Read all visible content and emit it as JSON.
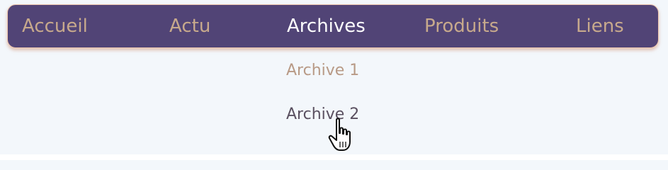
{
  "nav": {
    "items": [
      {
        "label": "Accueil",
        "active": false
      },
      {
        "label": "Actu",
        "active": false
      },
      {
        "label": "Archives",
        "active": true
      },
      {
        "label": "Produits",
        "active": false
      },
      {
        "label": "Liens",
        "active": false
      }
    ]
  },
  "dropdown": {
    "items": [
      {
        "label": "Archive 1",
        "hovered": false
      },
      {
        "label": "Archive 2",
        "hovered": true
      }
    ]
  },
  "colors": {
    "navbar_bg": "#514476",
    "navbar_border": "#f0c9b0",
    "nav_text": "#c7a98c",
    "nav_text_active": "#ffffff",
    "dropdown_text": "#b89a86",
    "dropdown_text_hover": "#5a5060",
    "page_bg": "#f3f7fb"
  },
  "icons": {
    "cursor": "hand-pointer-cursor-icon"
  }
}
